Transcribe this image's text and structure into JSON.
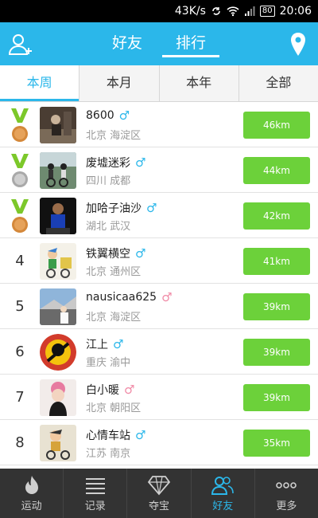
{
  "status_bar": {
    "speed": "43K/s",
    "battery": "80",
    "time": "20:06"
  },
  "header": {
    "add_friend_icon": "add-user-icon",
    "location_icon": "location-pin-icon",
    "tabs": [
      {
        "label": "好友"
      },
      {
        "label": "排行"
      }
    ]
  },
  "periods": [
    {
      "label": "本周"
    },
    {
      "label": "本月"
    },
    {
      "label": "本年"
    },
    {
      "label": "全部"
    }
  ],
  "accent": "#2bb7ea",
  "distance_color": "#6cd13a",
  "rankings": [
    {
      "rank": "",
      "medal": "bronze",
      "name": "8600",
      "gender": "male",
      "place": "北京 海淀区",
      "distance": "46km"
    },
    {
      "rank": "",
      "medal": "silver",
      "name": "废墟迷彩",
      "gender": "male",
      "place": "四川 成都",
      "distance": "44km"
    },
    {
      "rank": "",
      "medal": "bronze",
      "name": "加哈子油沙",
      "gender": "male",
      "place": "湖北 武汉",
      "distance": "42km"
    },
    {
      "rank": "4",
      "medal": "",
      "name": "铁翼横空",
      "gender": "male",
      "place": "北京 通州区",
      "distance": "41km"
    },
    {
      "rank": "5",
      "medal": "",
      "name": "nausicaa625",
      "gender": "female",
      "place": "北京 海淀区",
      "distance": "39km"
    },
    {
      "rank": "6",
      "medal": "",
      "name": "江上",
      "gender": "male",
      "place": "重庆 渝中",
      "distance": "39km"
    },
    {
      "rank": "7",
      "medal": "",
      "name": "白小暖",
      "gender": "female",
      "place": "北京 朝阳区",
      "distance": "39km"
    },
    {
      "rank": "8",
      "medal": "",
      "name": "心情车站",
      "gender": "male",
      "place": "江苏 南京",
      "distance": "35km"
    }
  ],
  "gender_symbols": {
    "male": "♂",
    "female": "♂"
  },
  "bottom_nav": [
    {
      "label": "运动",
      "icon": "flame-icon"
    },
    {
      "label": "记录",
      "icon": "list-icon"
    },
    {
      "label": "夺宝",
      "icon": "diamond-icon"
    },
    {
      "label": "好友",
      "icon": "friends-icon"
    },
    {
      "label": "更多",
      "icon": "more-icon"
    }
  ]
}
